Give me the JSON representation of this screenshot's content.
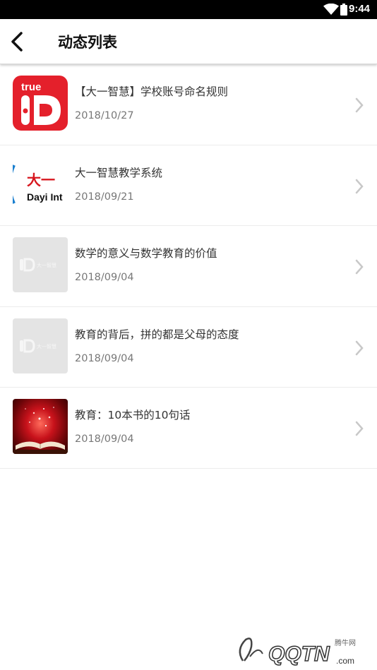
{
  "status_bar": {
    "time": "9:44"
  },
  "header": {
    "title": "动态列表"
  },
  "items": [
    {
      "title": "【大一智慧】学校账号命名规则",
      "date": "2018/10/27",
      "thumb": "trueid-logo"
    },
    {
      "title": "大一智慧教学系统",
      "date": "2018/09/21",
      "thumb": "dayi-logo"
    },
    {
      "title": "数学的意义与数学教育的价值",
      "date": "2018/09/04",
      "thumb": "placeholder-logo"
    },
    {
      "title": "教育的背后，拼的都是父母的态度",
      "date": "2018/09/04",
      "thumb": "placeholder-logo"
    },
    {
      "title": "教育：10本书的10句话",
      "date": "2018/09/04",
      "thumb": "open-book-photo"
    }
  ],
  "thumbs": {
    "trueid_text": "true",
    "dayi_cn": "大一",
    "dayi_en": "Dayi Int",
    "placeholder_text": "大一智慧"
  },
  "watermark": {
    "text": "QQTN",
    "suffix": ".com",
    "tag": "腾牛网"
  },
  "colors": {
    "accent_red": "#e4202b",
    "status_bar": "#000000",
    "text_primary": "#333333",
    "text_secondary": "#777777"
  }
}
